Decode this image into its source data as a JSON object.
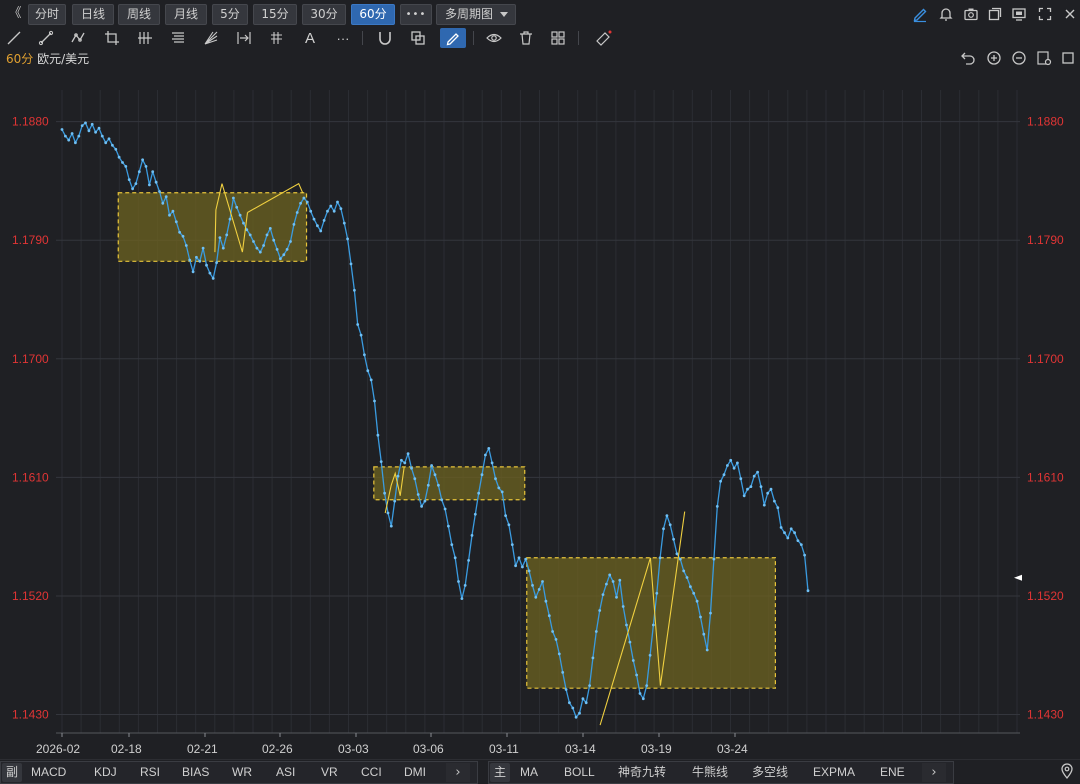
{
  "toolbar": {
    "collapse": "《",
    "periods": [
      "分时",
      "日线",
      "周线",
      "月线",
      "5分",
      "15分",
      "30分",
      "60分"
    ],
    "active_period": "60分",
    "more": "•••",
    "multi_period": "多周期图",
    "text_tool": "A",
    "more_tools": "···"
  },
  "symbol": {
    "period": "60分",
    "name": "欧元/美元"
  },
  "chart_data": {
    "type": "line",
    "title": "",
    "y_ticks": [
      "1.1880",
      "1.1790",
      "1.1700",
      "1.1610",
      "1.1520",
      "1.1430"
    ],
    "x_ticks": [
      "2026-02",
      "02-18",
      "02-21",
      "02-26",
      "03-03",
      "03-06",
      "03-11",
      "03-14",
      "03-19",
      "03-24"
    ],
    "ylim": [
      1.1416,
      1.1904
    ],
    "colors": {
      "line": "#3a9be0",
      "box_border": "#e8c43a",
      "box_fill": "#6e6320",
      "zigzag": "#f0d040",
      "ytick": "#e03535"
    },
    "series": [
      {
        "values": [
          1.1874,
          1.1869,
          1.1866,
          1.1871,
          1.1864,
          1.1869,
          1.1877,
          1.1879,
          1.1873,
          1.1878,
          1.1872,
          1.1875,
          1.1869,
          1.1864,
          1.1867,
          1.1862,
          1.1859,
          1.1853,
          1.1849,
          1.1846,
          1.1836,
          1.1829,
          1.1833,
          1.1842,
          1.1851,
          1.1846,
          1.1832,
          1.1842,
          1.1834,
          1.1827,
          1.1818,
          1.1823,
          1.1809,
          1.1812,
          1.1804,
          1.1796,
          1.1793,
          1.1786,
          1.1775,
          1.1766,
          1.1777,
          1.1774,
          1.1784,
          1.1771,
          1.1765,
          1.1761,
          1.1773,
          1.1792,
          1.1784,
          1.1794,
          1.1806,
          1.1822,
          1.1815,
          1.1809,
          1.1803,
          1.1798,
          1.1794,
          1.1789,
          1.1784,
          1.1781,
          1.1786,
          1.1794,
          1.1799,
          1.179,
          1.1783,
          1.1776,
          1.1779,
          1.1783,
          1.1789,
          1.1802,
          1.1811,
          1.1818,
          1.1822,
          1.1819,
          1.1812,
          1.1806,
          1.1801,
          1.1797,
          1.1805,
          1.1812,
          1.1816,
          1.1812,
          1.1819,
          1.1814,
          1.1803,
          1.1791,
          1.1772,
          1.1752,
          1.1726,
          1.1718,
          1.1703,
          1.1691,
          1.1684,
          1.1668,
          1.1642,
          1.1622,
          1.1598,
          1.1583,
          1.1573,
          1.1592,
          1.1611,
          1.1623,
          1.1621,
          1.1628,
          1.1617,
          1.1609,
          1.1597,
          1.1588,
          1.1592,
          1.1604,
          1.1619,
          1.1612,
          1.1604,
          1.1593,
          1.1586,
          1.1573,
          1.1559,
          1.1549,
          1.1531,
          1.1518,
          1.1528,
          1.1547,
          1.1566,
          1.1582,
          1.1598,
          1.1612,
          1.1627,
          1.1632,
          1.1621,
          1.1609,
          1.1602,
          1.1599,
          1.1581,
          1.1574,
          1.1559,
          1.1543,
          1.1549,
          1.1542,
          1.1548,
          1.1539,
          1.1528,
          1.1519,
          1.1525,
          1.1531,
          1.1516,
          1.1505,
          1.1493,
          1.1487,
          1.1476,
          1.1462,
          1.1449,
          1.1439,
          1.1435,
          1.1428,
          1.1431,
          1.1442,
          1.1439,
          1.1452,
          1.1473,
          1.1493,
          1.1509,
          1.1521,
          1.1529,
          1.1536,
          1.1531,
          1.1519,
          1.1532,
          1.1512,
          1.1498,
          1.1485,
          1.1471,
          1.146,
          1.1446,
          1.1442,
          1.1452,
          1.1475,
          1.1498,
          1.1522,
          1.1549,
          1.1571,
          1.1581,
          1.1574,
          1.1563,
          1.1552,
          1.1548,
          1.1539,
          1.1534,
          1.1527,
          1.1522,
          1.1516,
          1.1504,
          1.1491,
          1.1479,
          1.1507,
          1.1548,
          1.1588,
          1.1607,
          1.1612,
          1.1619,
          1.1623,
          1.1617,
          1.1621,
          1.1609,
          1.1596,
          1.1601,
          1.1603,
          1.1611,
          1.1614,
          1.1603,
          1.1589,
          1.1598,
          1.1601,
          1.1592,
          1.1587,
          1.1572,
          1.1568,
          1.1564,
          1.1571,
          1.1568,
          1.1562,
          1.1559,
          1.1551,
          1.1524
        ]
      }
    ],
    "zones": [
      {
        "x_start": 0.0754,
        "x_end": 0.3278,
        "y_top": 1.1826,
        "y_bottom": 1.1774
      },
      {
        "x_start": 0.418,
        "x_end": 0.6203,
        "y_top": 1.1618,
        "y_bottom": 1.1593
      },
      {
        "x_start": 0.623,
        "x_end": 0.9563,
        "y_top": 1.1549,
        "y_bottom": 1.145
      }
    ],
    "zigzags": [
      [
        [
          0.205,
          1.1781
        ],
        [
          0.2063,
          1.1813
        ],
        [
          0.2145,
          1.1833
        ]
      ],
      [
        [
          0.2145,
          1.1833
        ],
        [
          0.2418,
          1.1781
        ],
        [
          0.2486,
          1.1811
        ]
      ],
      [
        [
          0.2486,
          1.1811
        ],
        [
          0.3173,
          1.1833
        ],
        [
          0.3227,
          1.1826
        ]
      ],
      [
        [
          0.4333,
          1.1583
        ],
        [
          0.4413,
          1.1604
        ],
        [
          0.4467,
          1.1613
        ],
        [
          0.4533,
          1.1596
        ],
        [
          0.4587,
          1.1618
        ]
      ],
      [
        [
          0.7213,
          1.1422
        ],
        [
          0.7887,
          1.1549
        ],
        [
          0.8022,
          1.1452
        ],
        [
          0.8347,
          1.1584
        ]
      ]
    ]
  },
  "bottom_left": {
    "tag": "副",
    "items": [
      "MACD",
      "KDJ",
      "RSI",
      "BIAS",
      "WR",
      "ASI",
      "VR",
      "CCI",
      "DMI"
    ],
    "next": "›"
  },
  "bottom_right": {
    "tag": "主",
    "items": [
      "MA",
      "BOLL",
      "神奇九转",
      "牛熊线",
      "多空线",
      "EXPMA",
      "ENE"
    ],
    "next": "›"
  }
}
